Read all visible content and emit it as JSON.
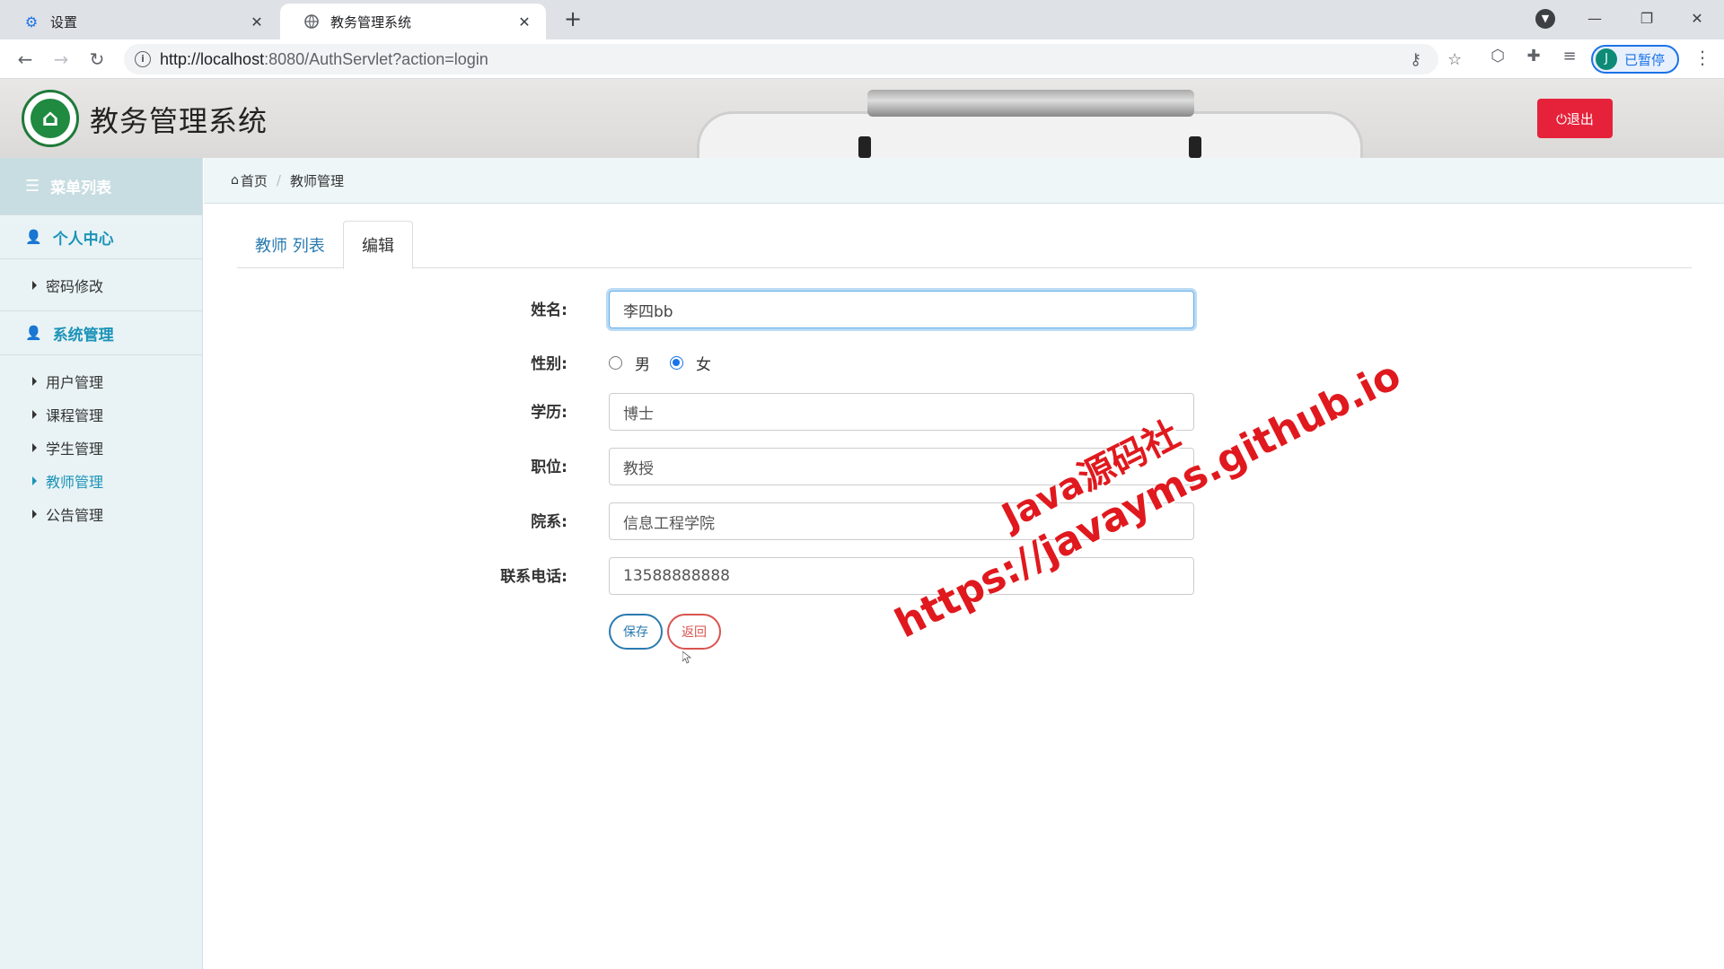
{
  "browser": {
    "tabs": [
      {
        "label": "设置",
        "icon": "gear-icon",
        "close": "✕"
      },
      {
        "label": "教务管理系统",
        "icon": "globe-icon",
        "close": "✕"
      }
    ],
    "new_tab": "+",
    "url_host": "http://localhost",
    "url_rest": ":8080/AuthServlet?action=login",
    "profile_initial": "J",
    "profile_label": "已暂停"
  },
  "app": {
    "title": "教务管理系统",
    "logout_label": "⏻退出"
  },
  "sidebar": {
    "header": "菜单列表",
    "sections": [
      {
        "label": "个人中心",
        "items": [
          "密码修改"
        ]
      },
      {
        "label": "系统管理",
        "items": [
          "用户管理",
          "课程管理",
          "学生管理",
          "教师管理",
          "公告管理"
        ]
      }
    ],
    "active_item": "教师管理"
  },
  "breadcrumb": {
    "home": "首页",
    "current": "教师管理"
  },
  "tabs": {
    "list": "教师 列表",
    "edit": "编辑"
  },
  "form": {
    "name_label": "姓名:",
    "name_value": "李四bb",
    "gender_label": "性别:",
    "gender_male": "男",
    "gender_female": "女",
    "gender_selected": "女",
    "education_label": "学历:",
    "education_value": "博士",
    "position_label": "职位:",
    "position_value": "教授",
    "department_label": "院系:",
    "department_value": "信息工程学院",
    "phone_label": "联系电话:",
    "phone_value": "13588888888",
    "save_label": "保存",
    "back_label": "返回"
  },
  "watermark": {
    "line1": "Java源码社",
    "line2": "https://javayms.github.io"
  },
  "colors": {
    "accent": "#1b93b8",
    "logout": "#e5223a",
    "save": "#2a7ab0",
    "back": "#d9534f",
    "watermark": "#e0191e"
  }
}
